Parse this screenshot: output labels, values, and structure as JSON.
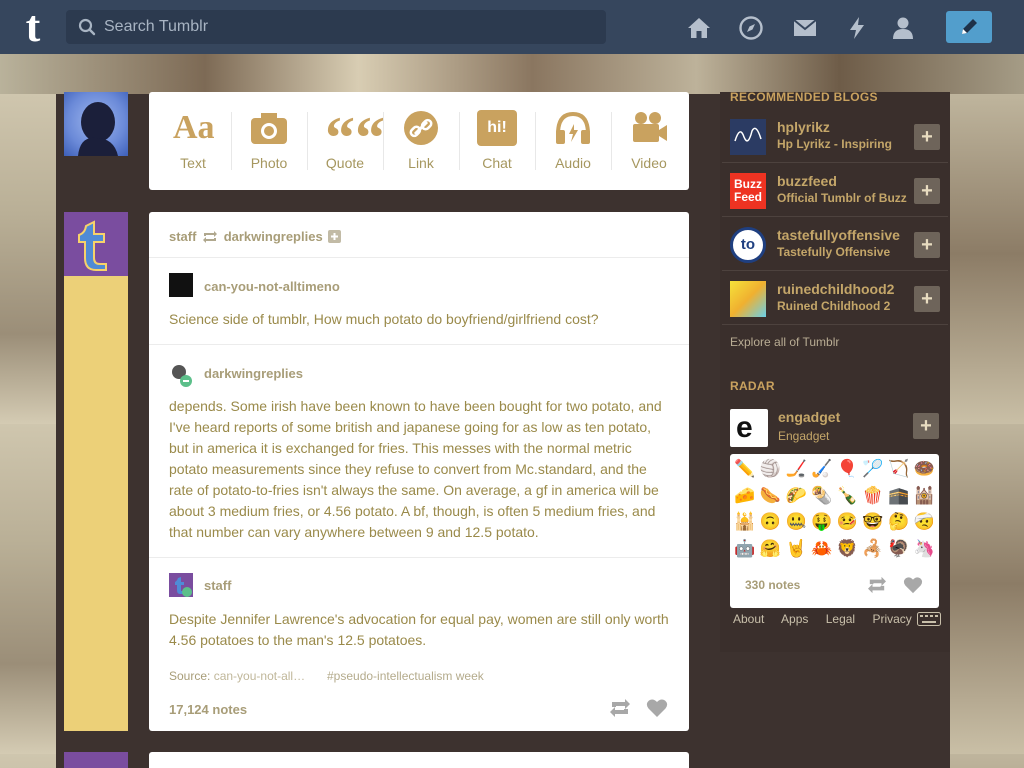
{
  "colors": {
    "topbar": "#36465d",
    "accent_blue": "#529ecc",
    "text_gold": "#a89d78",
    "post_text": "#9a8a4a",
    "sidebar_bg": "#3a2f2c"
  },
  "header": {
    "logo": "t",
    "search_placeholder": "Search Tumblr",
    "nav_icons": [
      "home-icon",
      "explore-compass-icon",
      "inbox-mail-icon",
      "activity-bolt-icon",
      "account-person-icon",
      "compose-pencil-icon"
    ]
  },
  "post_types": [
    {
      "label": "Text",
      "icon": "text-icon",
      "glyph": "Aa"
    },
    {
      "label": "Photo",
      "icon": "camera-icon"
    },
    {
      "label": "Quote",
      "icon": "quote-icon",
      "glyph": "““"
    },
    {
      "label": "Link",
      "icon": "link-icon"
    },
    {
      "label": "Chat",
      "icon": "chat-icon",
      "glyph": "hi!"
    },
    {
      "label": "Audio",
      "icon": "headphones-icon"
    },
    {
      "label": "Video",
      "icon": "video-camera-icon"
    }
  ],
  "post": {
    "header_blog": "staff",
    "header_reblogged_from": "darkwingreplies",
    "reblogs": [
      {
        "blog": "can-you-not-alltimeno",
        "text": "Science side of tumblr, How much potato do boyfriend/girlfriend cost?"
      },
      {
        "blog": "darkwingreplies",
        "text": "depends. Some irish have been known to have been bought for two potato, and I've heard reports of some british and japanese going for as low as ten potato, but in america it is exchanged for fries. This messes with the normal metric potato measurements since they refuse to convert from Mc.standard, and the rate of potato-to-fries isn't always the same. On average, a gf in america will be about 3 medium fries, or 4.56 potato. A bf, though, is often 5 medium fries, and that number can vary anywhere between 9 and 12.5 potato."
      },
      {
        "blog": "staff",
        "text": "Despite Jennifer Lawrence's advocation for equal pay, women are still only worth 4.56 potatoes to the man's 12.5 potatoes."
      }
    ],
    "source_label": "Source:",
    "source_link": "can-you-not-all…",
    "tag": "#pseudo-intellectualism week",
    "notes": "17,124 notes"
  },
  "sidebar": {
    "recommended_heading": "RECOMMENDED BLOGS",
    "recommended": [
      {
        "name": "hplyrikz",
        "title": "Hp Lyrikz - Inspiring"
      },
      {
        "name": "buzzfeed",
        "title": "Official Tumblr of BuzzFeed"
      },
      {
        "name": "tastefullyoffensive",
        "title": "Tastefully Offensive"
      },
      {
        "name": "ruinedchildhood2",
        "title": "Ruined Childhood 2"
      }
    ],
    "buzzfeed_logo": "Buzz Feed",
    "tastefully_logo": "to",
    "follow_symbol": "+",
    "explore": "Explore all of Tumblr",
    "radar_heading": "RADAR",
    "radar": {
      "name": "engadget",
      "title": "Engadget",
      "logo": "e",
      "notes": "330 notes",
      "emojis": [
        "✏️",
        "🏐",
        "🏒",
        "🏑",
        "🎈",
        "🏸",
        "🏹",
        "🍩",
        "🧀",
        "🌭",
        "🌮",
        "🌯",
        "🍾",
        "🍿",
        "🕋",
        "🕍",
        "🕌",
        "🙃",
        "🤐",
        "🤑",
        "🤒",
        "🤓",
        "🤔",
        "🤕",
        "🤖",
        "🤗",
        "🤘",
        "🦀",
        "🦁",
        "🦂",
        "🦃",
        "🦄"
      ]
    },
    "footer": [
      "About",
      "Apps",
      "Legal",
      "Privacy"
    ]
  }
}
